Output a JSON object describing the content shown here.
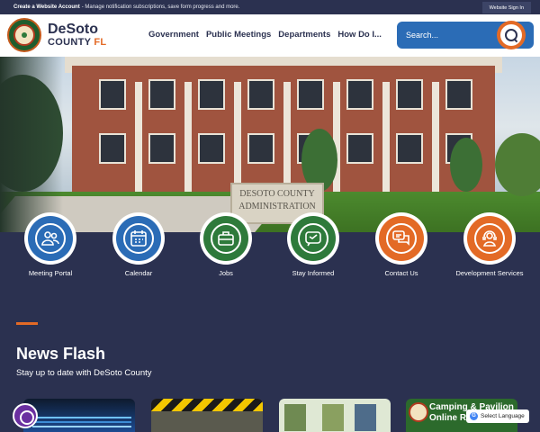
{
  "topbar": {
    "create_account": "Create a Website Account",
    "create_account_desc": "- Manage notification subscriptions, save form progress and more.",
    "sign_in": "Website Sign In"
  },
  "header": {
    "brand_line1": "DeSoto",
    "brand_line2_county": "COUNTY",
    "brand_line2_state": "FL",
    "nav": [
      "Government",
      "Public Meetings",
      "Departments",
      "How Do I..."
    ],
    "search_placeholder": "Search..."
  },
  "hero": {
    "sign_line1": "DESOTO COUNTY",
    "sign_line2": "ADMINISTRATION"
  },
  "quick_links": [
    {
      "label": "Meeting Portal",
      "icon": "people-icon",
      "color": "#2b6cb6"
    },
    {
      "label": "Calendar",
      "icon": "calendar-icon",
      "color": "#2b6cb6"
    },
    {
      "label": "Jobs",
      "icon": "briefcase-icon",
      "color": "#2e7a3b"
    },
    {
      "label": "Stay Informed",
      "icon": "chat-icon",
      "color": "#2e7a3b"
    },
    {
      "label": "Contact Us",
      "icon": "speech-bubbles-icon",
      "color": "#e36a26"
    },
    {
      "label": "Development Services",
      "icon": "support-icon",
      "color": "#e36a26"
    }
  ],
  "news": {
    "title": "News Flash",
    "subtitle": "Stay up to date with DeSoto County",
    "card4_title": "Camping & Pavilion Online Re"
  },
  "widgets": {
    "language": "Select Language"
  },
  "colors": {
    "navy": "#2b3150",
    "blue": "#2b6cb6",
    "green": "#2e7a3b",
    "orange": "#e36a26"
  }
}
